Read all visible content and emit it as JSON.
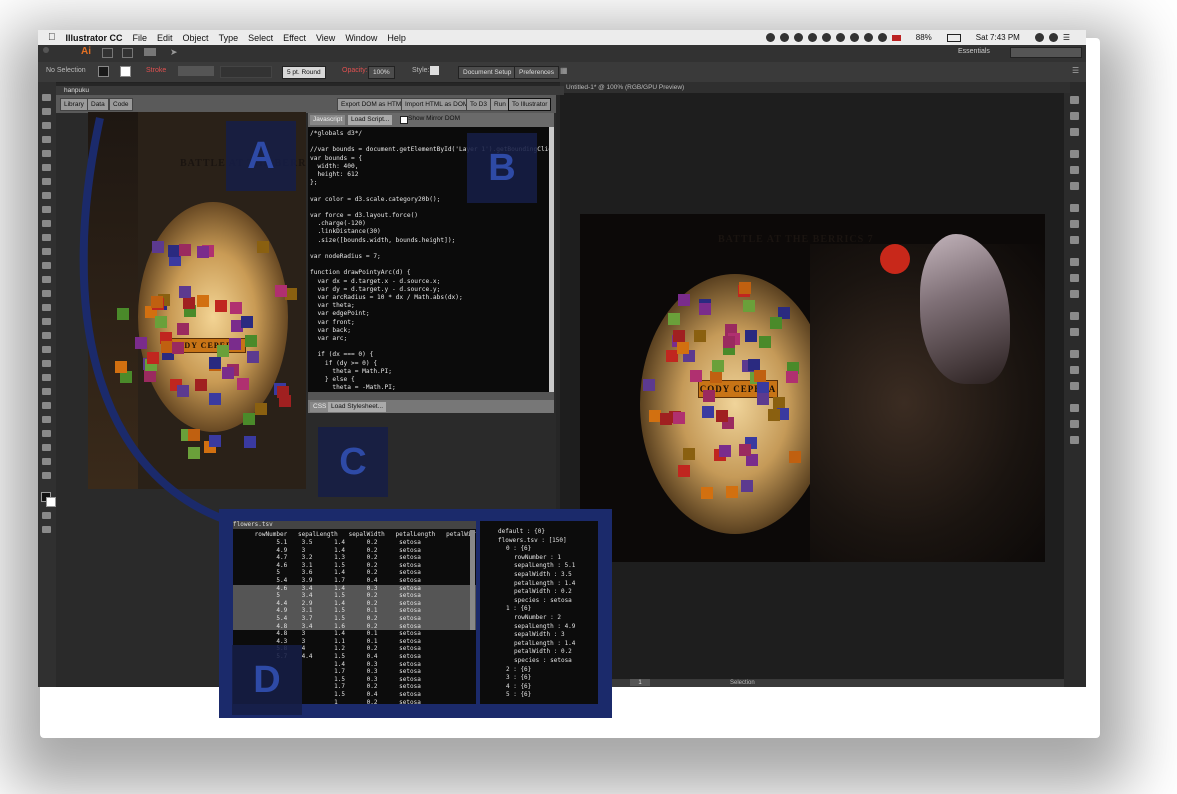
{
  "menubar": {
    "app_name": "Illustrator CC",
    "menus": [
      "File",
      "Edit",
      "Object",
      "Type",
      "Select",
      "Effect",
      "View",
      "Window",
      "Help"
    ],
    "battery": "88%",
    "clock": "Sat 7:43 PM"
  },
  "appbar": {
    "logo": "Ai",
    "workspace": "Essentials"
  },
  "control_bar": {
    "selection": "No Selection",
    "stroke_label": "Stroke",
    "brush": "5 pt. Round",
    "opacity_label": "Opacity:",
    "opacity_value": "100%",
    "style_label": "Style:",
    "doc_setup": "Document Setup",
    "preferences": "Preferences"
  },
  "plugin": {
    "title": "hanpuku",
    "tabs": [
      "Library",
      "Data",
      "Code"
    ],
    "actions": [
      "Export DOM as HTML",
      "Import HTML as DOM",
      "To D3",
      "Run",
      "To Illustrator"
    ],
    "editor_tab": "Javascript",
    "load_script": "Load Script...",
    "mirror_label": "Show Mirror DOM",
    "css_tab": "CSS",
    "load_stylesheet": "Load Stylesheet...",
    "code_lines": [
      "/*globals d3*/",
      "",
      "//var bounds = document.getElementById('Layer 1').getBoundingClientRect",
      "var bounds = {",
      "  width: 400,",
      "  height: 612",
      "};",
      "",
      "var color = d3.scale.category20b();",
      "",
      "var force = d3.layout.force()",
      "  .charge(-120)",
      "  .linkDistance(30)",
      "  .size([bounds.width, bounds.height]);",
      "",
      "var nodeRadius = 7;",
      "",
      "function drawPointyArc(d) {",
      "  var dx = d.target.x - d.source.x;",
      "  var dy = d.target.y - d.source.y;",
      "  var arcRadius = 10 * dx / Math.abs(dx);",
      "  var theta;",
      "  var edgePoint;",
      "  var front;",
      "  var back;",
      "  var arc;",
      "",
      "  if (dx === 0) {",
      "    if (dy >= 0) {",
      "      theta = Math.PI;",
      "    } else {",
      "      theta = -Math.PI;",
      "    }",
      "    edgePoint = {"
    ]
  },
  "poster": {
    "title": "BATTLE AT THE BERRICS 7",
    "name": "CODY CEPEDA"
  },
  "document": {
    "tab": "Untitled-1* @ 100% (RGB/GPU Preview)",
    "status": "Selection",
    "page": "1"
  },
  "labels": {
    "a": "A",
    "b": "B",
    "c": "C",
    "d": "D"
  },
  "data_table": {
    "header_label": "flowers.tsv",
    "columns": [
      "rowNumber",
      "sepalLength",
      "sepalWidth",
      "petalLength",
      "petalWidth"
    ],
    "rows": [
      [
        "5.1",
        "3.5",
        "1.4",
        "0.2",
        "setosa"
      ],
      [
        "4.9",
        "3",
        "1.4",
        "0.2",
        "setosa"
      ],
      [
        "4.7",
        "3.2",
        "1.3",
        "0.2",
        "setosa"
      ],
      [
        "4.6",
        "3.1",
        "1.5",
        "0.2",
        "setosa"
      ],
      [
        "5",
        "3.6",
        "1.4",
        "0.2",
        "setosa"
      ],
      [
        "5.4",
        "3.9",
        "1.7",
        "0.4",
        "setosa"
      ],
      [
        "4.6",
        "3.4",
        "1.4",
        "0.3",
        "setosa"
      ],
      [
        "5",
        "3.4",
        "1.5",
        "0.2",
        "setosa"
      ],
      [
        "4.4",
        "2.9",
        "1.4",
        "0.2",
        "setosa"
      ],
      [
        "4.9",
        "3.1",
        "1.5",
        "0.1",
        "setosa"
      ],
      [
        "5.4",
        "3.7",
        "1.5",
        "0.2",
        "setosa"
      ],
      [
        "4.8",
        "3.4",
        "1.6",
        "0.2",
        "setosa"
      ],
      [
        "4.8",
        "3",
        "1.4",
        "0.1",
        "setosa"
      ],
      [
        "4.3",
        "3",
        "1.1",
        "0.1",
        "setosa"
      ],
      [
        "5.8",
        "4",
        "1.2",
        "0.2",
        "setosa"
      ],
      [
        "5.7",
        "4.4",
        "1.5",
        "0.4",
        "setosa"
      ],
      [
        "",
        "",
        "1.4",
        "0.3",
        "setosa"
      ],
      [
        "",
        "",
        "1.7",
        "0.3",
        "setosa"
      ],
      [
        "",
        "",
        "1.5",
        "0.3",
        "setosa"
      ],
      [
        "",
        "",
        "1.7",
        "0.2",
        "setosa"
      ],
      [
        "",
        "",
        "1.5",
        "0.4",
        "setosa"
      ],
      [
        "",
        "",
        "1",
        "0.2",
        "setosa"
      ],
      [
        "",
        "",
        "1.7",
        "0.5",
        "setosa"
      ]
    ],
    "selected_rows": [
      6,
      7,
      8,
      9,
      10,
      11
    ]
  },
  "data_tree": {
    "lines": [
      "default : {0}",
      "flowers.tsv : [150]",
      "0 : {6}",
      "rowNumber : 1",
      "sepalLength : 5.1",
      "sepalWidth : 3.5",
      "petalLength : 1.4",
      "petalWidth : 0.2",
      "species : setosa",
      "1 : {6}",
      "rowNumber : 2",
      "sepalLength : 4.9",
      "sepalWidth : 3",
      "petalLength : 1.4",
      "petalWidth : 0.2",
      "species : setosa",
      "2 : {6}",
      "3 : {6}",
      "4 : {6}",
      "5 : {6}"
    ],
    "indents": [
      0,
      0,
      1,
      2,
      2,
      2,
      2,
      2,
      2,
      1,
      2,
      2,
      2,
      2,
      2,
      2,
      1,
      1,
      1,
      1
    ]
  },
  "colors": {
    "accent_blue": "#1b2a6b",
    "label_blue": "#2e4aa6",
    "name_orange": "#c87416",
    "node_palette": [
      "#7a2c8c",
      "#9a2a5f",
      "#5c3a8f",
      "#3a3aa0",
      "#2a2a80",
      "#6aa03a",
      "#4a8a2a",
      "#c0261f",
      "#a02020",
      "#d27010",
      "#c06010",
      "#8a6010",
      "#b03070"
    ]
  }
}
